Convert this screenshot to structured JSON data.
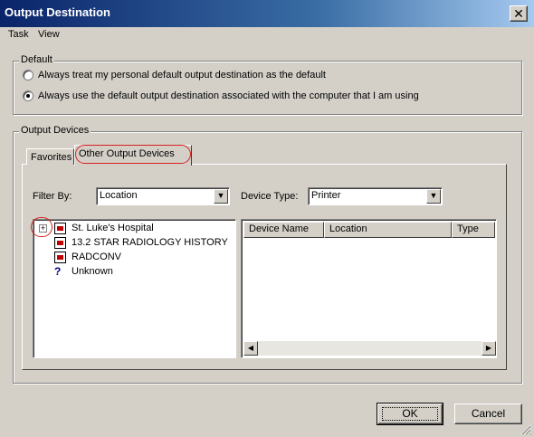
{
  "window": {
    "title": "Output Destination",
    "close_glyph": "✕"
  },
  "menu": {
    "items": [
      "Task",
      "View"
    ]
  },
  "default_group": {
    "legend": "Default",
    "options": [
      {
        "label": "Always treat my personal default output destination as the default",
        "checked": false
      },
      {
        "label": "Always use the default output destination associated with the computer that I am using",
        "checked": true
      }
    ]
  },
  "devices_group": {
    "legend": "Output Devices",
    "tabs": [
      {
        "label": "Favorites",
        "active": false
      },
      {
        "label": "Other Output Devices",
        "active": true
      }
    ],
    "filter_by": {
      "label": "Filter By:",
      "value": "Location"
    },
    "device_type": {
      "label": "Device Type:",
      "value": "Printer"
    },
    "tree": [
      {
        "label": "St. Luke's Hospital",
        "icon": "building-icon",
        "expandable": true
      },
      {
        "label": "13.2 STAR RADIOLOGY HISTORY",
        "icon": "building-icon",
        "expandable": false
      },
      {
        "label": "RADCONV",
        "icon": "building-icon",
        "expandable": false
      },
      {
        "label": "Unknown",
        "icon": "question-icon",
        "expandable": false
      }
    ],
    "list_columns": [
      "Device Name",
      "Location",
      "Type"
    ]
  },
  "buttons": {
    "ok": "OK",
    "cancel": "Cancel"
  },
  "colors": {
    "annotation": "#d62020",
    "title_bar": "#0a246a",
    "face": "#d4d0c8"
  }
}
